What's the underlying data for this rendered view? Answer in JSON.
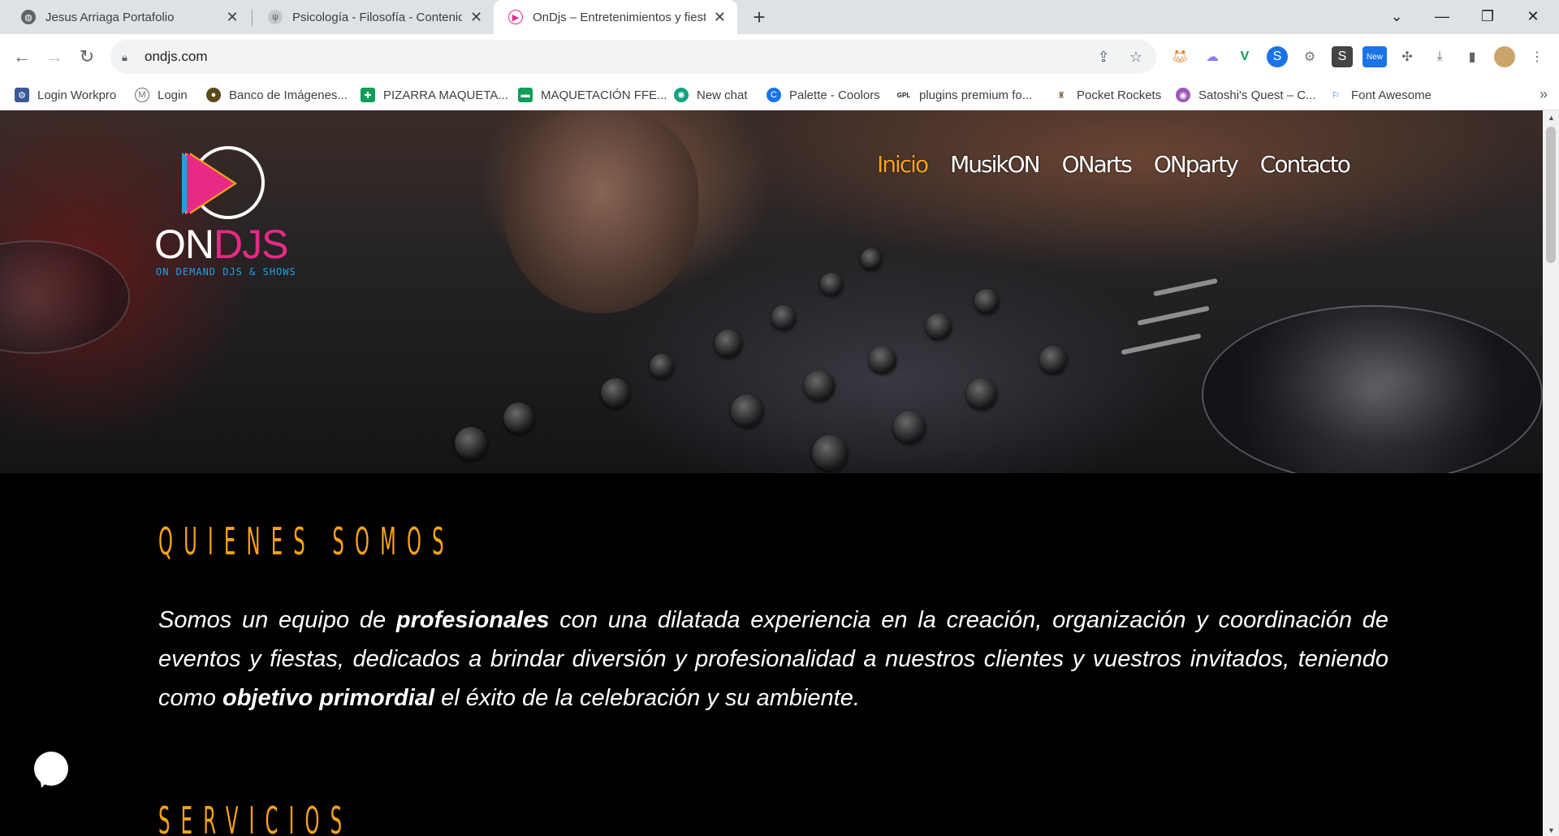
{
  "tabs": [
    {
      "title": "Jesus Arriaga Portafolio",
      "active": false
    },
    {
      "title": "Psicología - Filosofía - Contenido",
      "active": false
    },
    {
      "title": "OnDjs – Entretenimientos y fiesta",
      "active": true
    }
  ],
  "toolbar": {
    "url": "ondjs.com",
    "new_badge": "New"
  },
  "bookmarks": [
    {
      "label": "Login Workpro",
      "icon": "workpro-icon",
      "color": "#3b5998"
    },
    {
      "label": "Login",
      "icon": "login-icon",
      "color": "#6d6d6d"
    },
    {
      "label": "Banco de Imágenes...",
      "icon": "image-bank-icon",
      "color": "#5a4a1c"
    },
    {
      "label": "PIZARRA MAQUETA...",
      "icon": "sheets-icon",
      "color": "#0f9d58"
    },
    {
      "label": "MAQUETACIÓN FFE...",
      "icon": "chat-icon",
      "color": "#0f9d58"
    },
    {
      "label": "New chat",
      "icon": "openai-icon",
      "color": "#10a37f"
    },
    {
      "label": "Palette - Coolors",
      "icon": "coolors-icon",
      "color": "#1a73e8"
    },
    {
      "label": "plugins premium fo...",
      "icon": "gpl-icon",
      "color": "#222222"
    },
    {
      "label": "Pocket Rockets",
      "icon": "rocket-icon",
      "color": "#8a6b4a"
    },
    {
      "label": "Satoshi's Quest – C...",
      "icon": "satoshi-icon",
      "color": "#9b59b6"
    },
    {
      "label": "Font Awesome",
      "icon": "flag-icon",
      "color": "#1a73e8"
    }
  ],
  "site": {
    "logo": {
      "on": "ON",
      "djs": "DJS",
      "tagline": "ON DEMAND DJS & SHOWS"
    },
    "menu": [
      {
        "label": "Inicio",
        "active": true
      },
      {
        "label": "MusikON",
        "active": false
      },
      {
        "label": "ONarts",
        "active": false
      },
      {
        "label": "ONparty",
        "active": false
      },
      {
        "label": "Contacto",
        "active": false
      }
    ],
    "about": {
      "heading": "QUIENES SOMOS",
      "p1": "Somos un equipo de ",
      "b1": "profesionales",
      "p2": " con una dilatada experiencia en la creación, organización y coordinación de eventos y fiestas, dedicados a brindar diversión y profesionalidad a nuestros clientes y vuestros invitados, teniendo como ",
      "b2": "objetivo primordial",
      "p3": "  el éxito de la celebración y su ambiente."
    },
    "services": {
      "heading": "SERVICIOS"
    }
  },
  "colors": {
    "accent": "#f6a21a",
    "brand_pink": "#e82a86",
    "brand_blue": "#1da1e6"
  }
}
